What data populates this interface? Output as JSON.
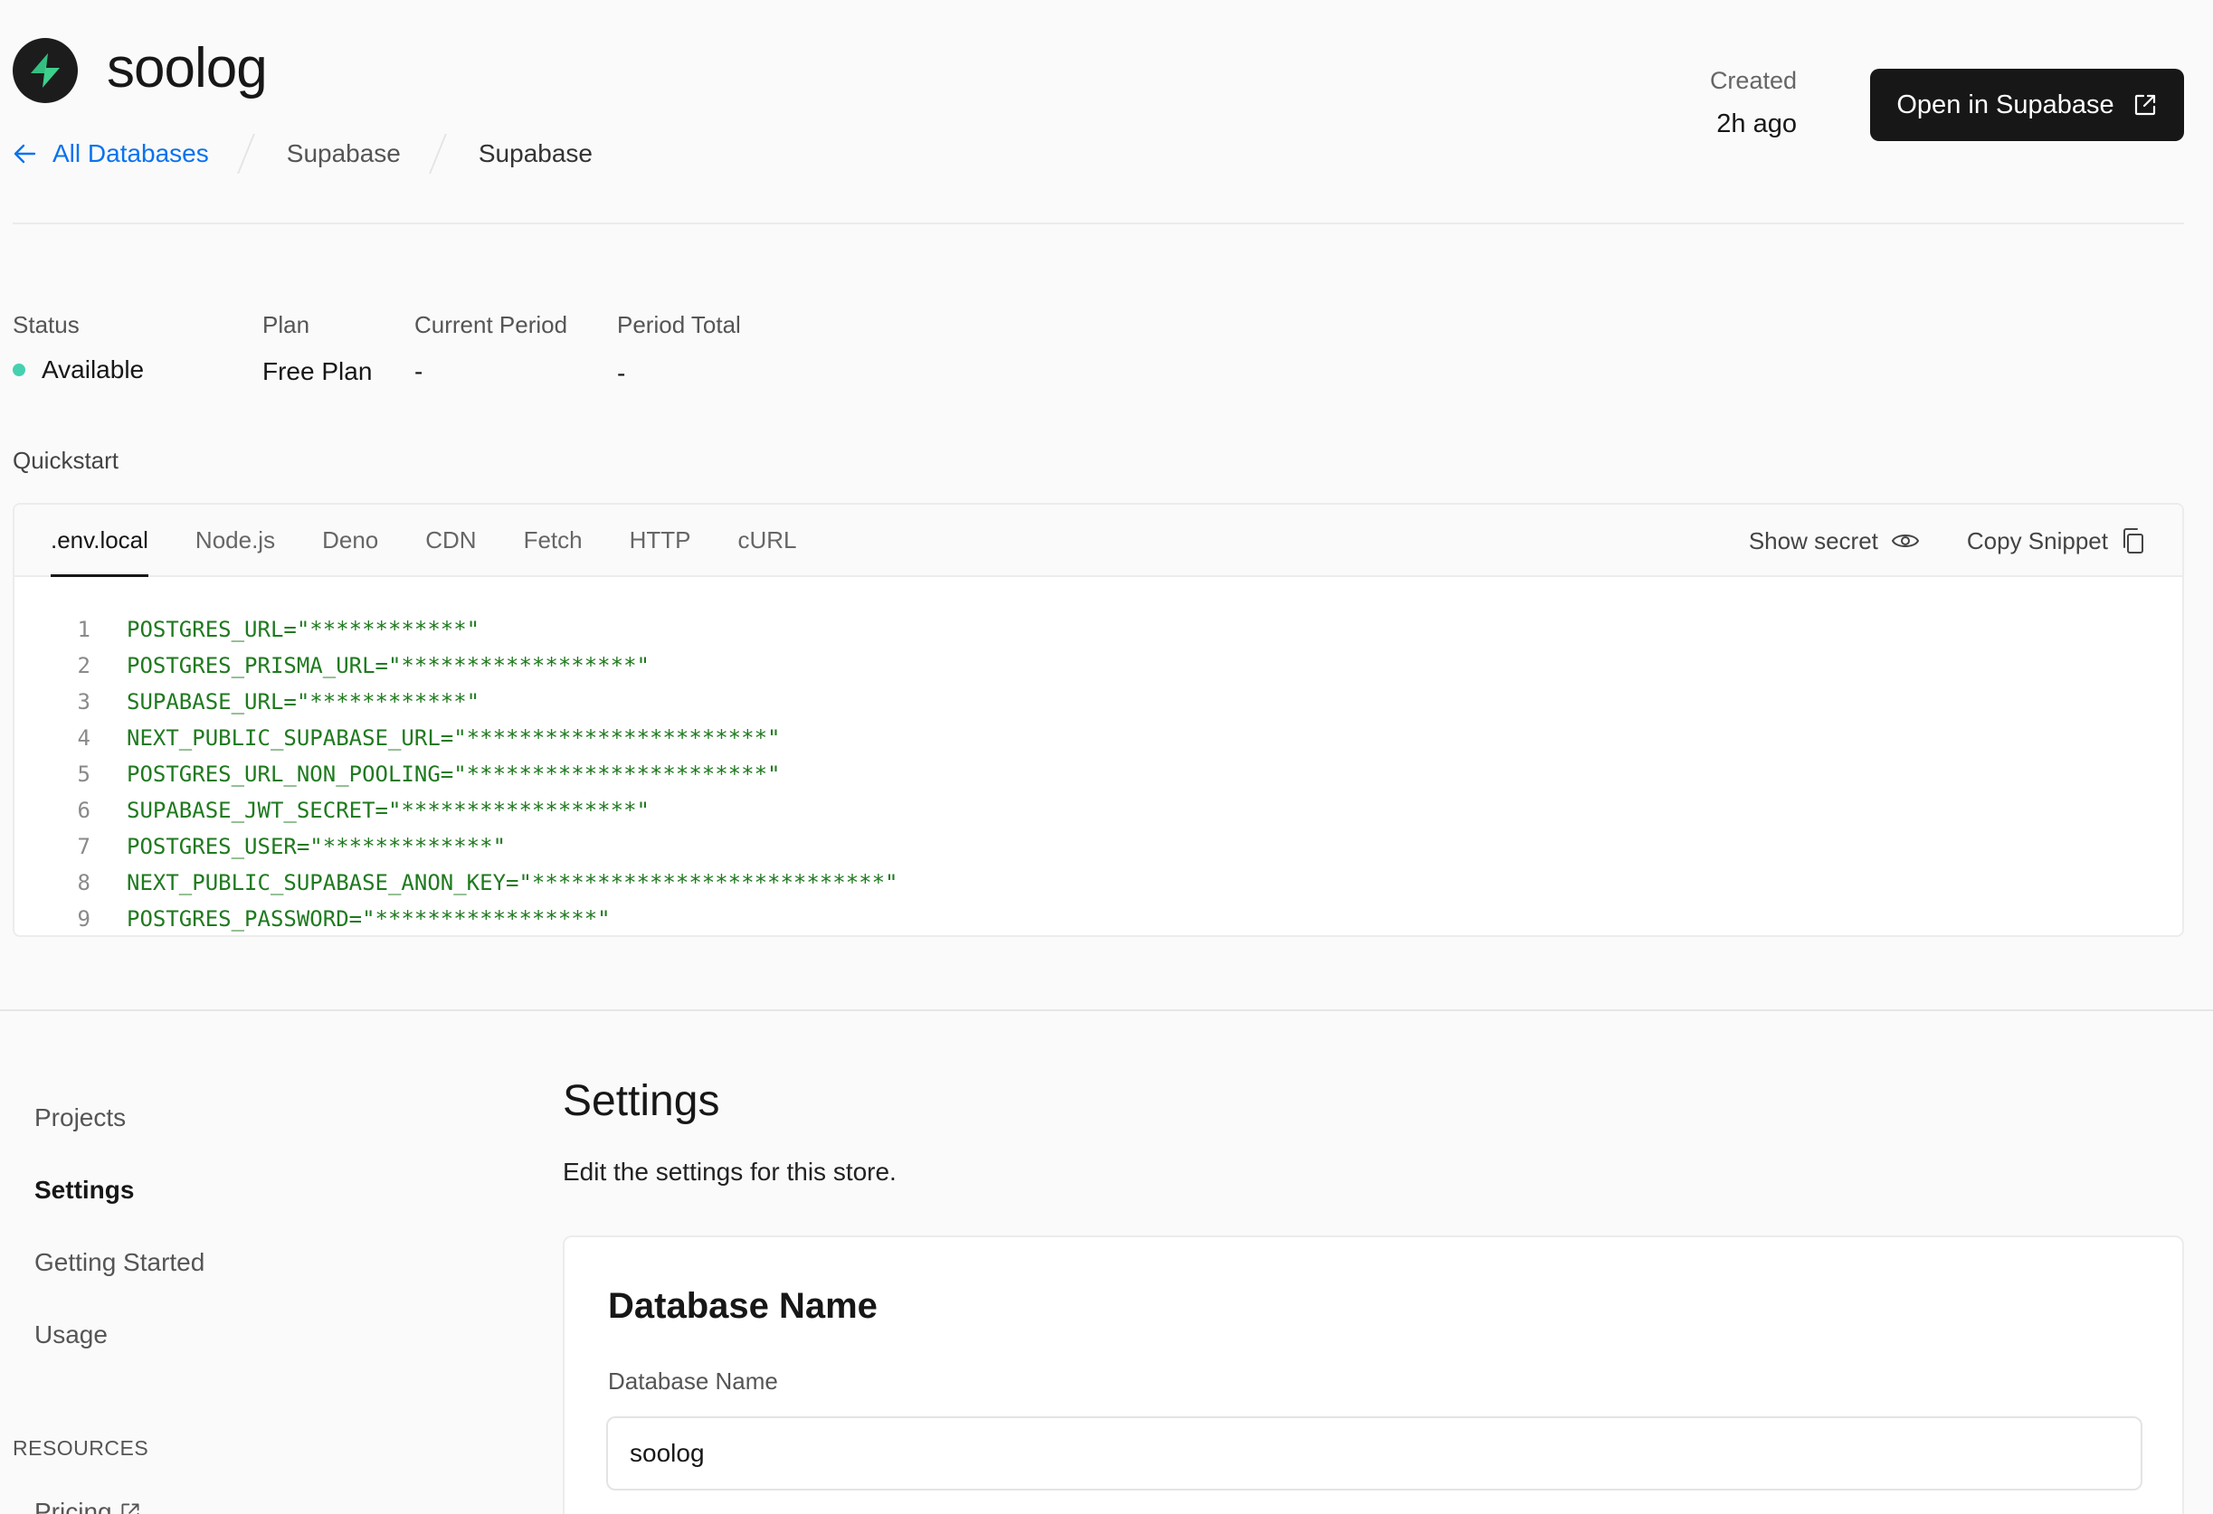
{
  "header": {
    "title": "soolog",
    "breadcrumb": {
      "back_label": "All Databases",
      "items": [
        "Supabase",
        "Supabase"
      ]
    },
    "created_label": "Created",
    "created_value": "2h ago",
    "open_button_label": "Open in Supabase"
  },
  "stats": {
    "status_label": "Status",
    "status_value": "Available",
    "status_color": "#45d0b0",
    "plan_label": "Plan",
    "plan_value": "Free Plan",
    "current_period_label": "Current Period",
    "current_period_value": "-",
    "period_total_label": "Period Total",
    "period_total_value": "-"
  },
  "quickstart": {
    "label": "Quickstart",
    "tabs": [
      ".env.local",
      "Node.js",
      "Deno",
      "CDN",
      "Fetch",
      "HTTP",
      "cURL"
    ],
    "active_tab": ".env.local",
    "show_secret_label": "Show secret",
    "copy_snippet_label": "Copy Snippet",
    "lines": [
      {
        "num": "1",
        "code": "POSTGRES_URL=\"************\""
      },
      {
        "num": "2",
        "code": "POSTGRES_PRISMA_URL=\"******************\""
      },
      {
        "num": "3",
        "code": "SUPABASE_URL=\"************\""
      },
      {
        "num": "4",
        "code": "NEXT_PUBLIC_SUPABASE_URL=\"***********************\""
      },
      {
        "num": "5",
        "code": "POSTGRES_URL_NON_POOLING=\"***********************\""
      },
      {
        "num": "6",
        "code": "SUPABASE_JWT_SECRET=\"******************\""
      },
      {
        "num": "7",
        "code": "POSTGRES_USER=\"*************\""
      },
      {
        "num": "8",
        "code": "NEXT_PUBLIC_SUPABASE_ANON_KEY=\"***************************\""
      },
      {
        "num": "9",
        "code": "POSTGRES_PASSWORD=\"*****************\""
      }
    ]
  },
  "sidenav": {
    "items": [
      "Projects",
      "Settings",
      "Getting Started",
      "Usage"
    ],
    "active": "Settings",
    "resources_label": "RESOURCES",
    "pricing_label": "Pricing"
  },
  "settings": {
    "title": "Settings",
    "description": "Edit the settings for this store.",
    "card_title": "Database Name",
    "field_label": "Database Name",
    "field_value": "soolog"
  }
}
